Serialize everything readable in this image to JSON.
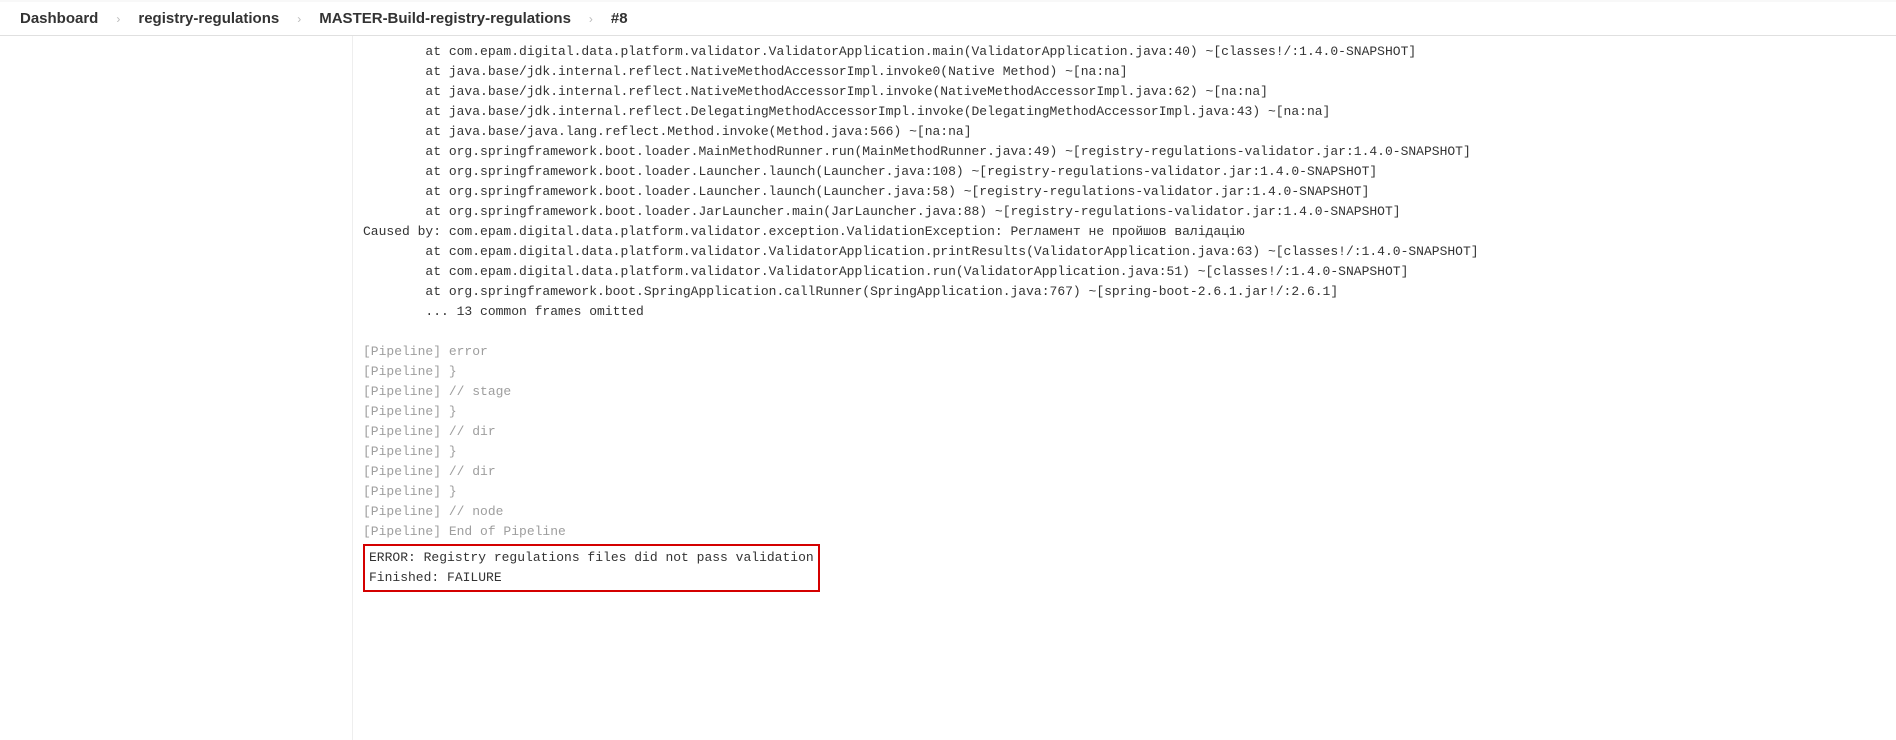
{
  "breadcrumb": {
    "items": [
      {
        "label": "Dashboard"
      },
      {
        "label": "registry-regulations"
      },
      {
        "label": "MASTER-Build-registry-regulations"
      },
      {
        "label": "#8"
      }
    ]
  },
  "console": {
    "stack": [
      "        at com.epam.digital.data.platform.validator.ValidatorApplication.main(ValidatorApplication.java:40) ~[classes!/:1.4.0-SNAPSHOT]",
      "        at java.base/jdk.internal.reflect.NativeMethodAccessorImpl.invoke0(Native Method) ~[na:na]",
      "        at java.base/jdk.internal.reflect.NativeMethodAccessorImpl.invoke(NativeMethodAccessorImpl.java:62) ~[na:na]",
      "        at java.base/jdk.internal.reflect.DelegatingMethodAccessorImpl.invoke(DelegatingMethodAccessorImpl.java:43) ~[na:na]",
      "        at java.base/java.lang.reflect.Method.invoke(Method.java:566) ~[na:na]",
      "        at org.springframework.boot.loader.MainMethodRunner.run(MainMethodRunner.java:49) ~[registry-regulations-validator.jar:1.4.0-SNAPSHOT]",
      "        at org.springframework.boot.loader.Launcher.launch(Launcher.java:108) ~[registry-regulations-validator.jar:1.4.0-SNAPSHOT]",
      "        at org.springframework.boot.loader.Launcher.launch(Launcher.java:58) ~[registry-regulations-validator.jar:1.4.0-SNAPSHOT]",
      "        at org.springframework.boot.loader.JarLauncher.main(JarLauncher.java:88) ~[registry-regulations-validator.jar:1.4.0-SNAPSHOT]",
      "Caused by: com.epam.digital.data.platform.validator.exception.ValidationException: Регламент не пройшов валідацію",
      "        at com.epam.digital.data.platform.validator.ValidatorApplication.printResults(ValidatorApplication.java:63) ~[classes!/:1.4.0-SNAPSHOT]",
      "        at com.epam.digital.data.platform.validator.ValidatorApplication.run(ValidatorApplication.java:51) ~[classes!/:1.4.0-SNAPSHOT]",
      "        at org.springframework.boot.SpringApplication.callRunner(SpringApplication.java:767) ~[spring-boot-2.6.1.jar!/:2.6.1]",
      "        ... 13 common frames omitted"
    ],
    "pipeline": [
      "[Pipeline] error",
      "[Pipeline] }",
      "[Pipeline] // stage",
      "[Pipeline] }",
      "[Pipeline] // dir",
      "[Pipeline] }",
      "[Pipeline] // dir",
      "[Pipeline] }",
      "[Pipeline] // node",
      "[Pipeline] End of Pipeline"
    ],
    "error_line": "ERROR: Registry regulations files did not pass validation",
    "finished_line": "Finished: FAILURE"
  }
}
